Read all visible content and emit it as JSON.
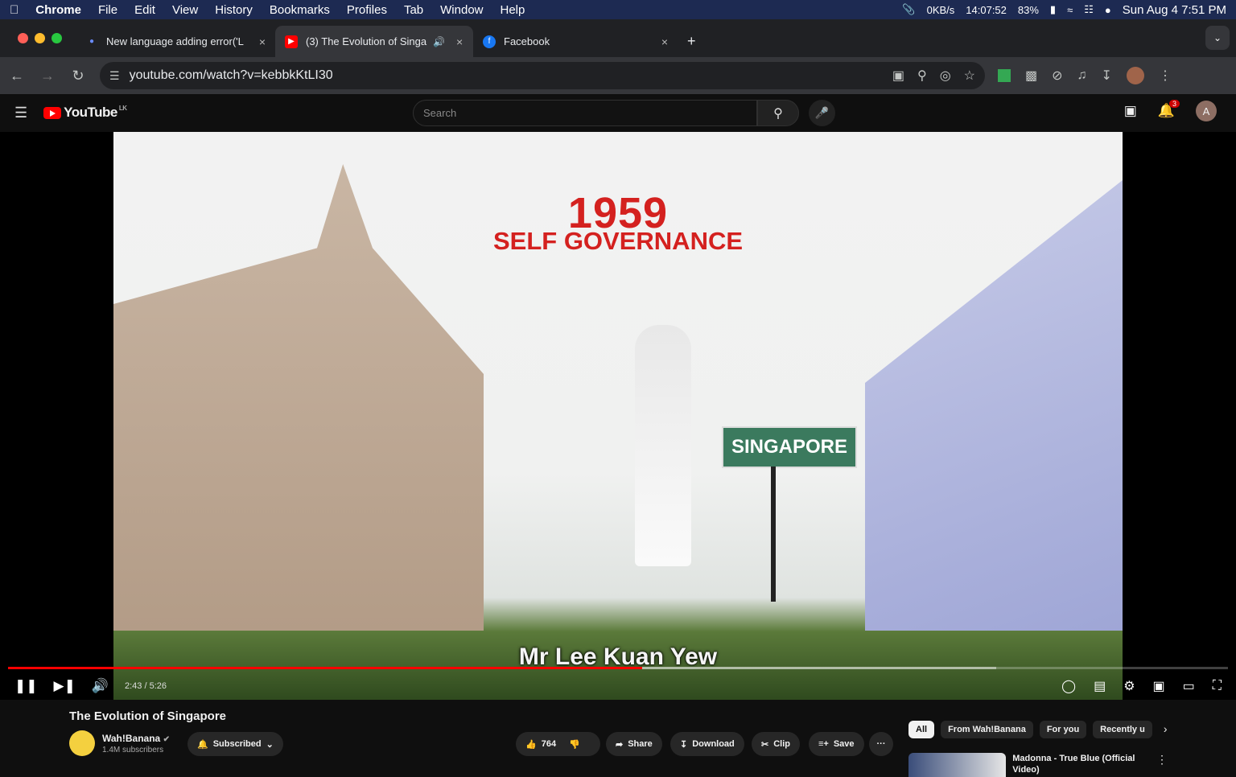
{
  "menubar": {
    "app": "Chrome",
    "items": [
      "File",
      "Edit",
      "View",
      "History",
      "Bookmarks",
      "Profiles",
      "Tab",
      "Window",
      "Help"
    ],
    "net": "0KB/s",
    "timer": "14:07:52",
    "battery": "83%",
    "clock": "Sun Aug 4  7:51 PM"
  },
  "tabs": [
    {
      "title": "New language adding error('L",
      "close": "×"
    },
    {
      "title": "(3) The Evolution of Singa",
      "close": "×"
    },
    {
      "title": "Facebook",
      "close": "×"
    }
  ],
  "address": {
    "url": "youtube.com/watch?v=kebbkKtLI30"
  },
  "youtube": {
    "logo": "YouTube",
    "region": "LK",
    "search_placeholder": "Search",
    "notif_count": "3",
    "avatar_letter": "A"
  },
  "video": {
    "year": "1959",
    "headline": "SELF GOVERNANCE",
    "sign": "SINGAPORE",
    "caption": "Mr Lee Kuan Yew",
    "time": "2:43 / 5:26",
    "progress": 0.52,
    "buffered": 0.81
  },
  "meta": {
    "title": "The Evolution of Singapore",
    "channel": "Wah!Banana",
    "subscribers": "1.4M subscribers",
    "subscribed": "Subscribed",
    "likes": "764",
    "share": "Share",
    "download": "Download",
    "clip": "Clip",
    "save": "Save",
    "more": "···"
  },
  "chips": [
    "All",
    "From Wah!Banana",
    "For you",
    "Recently u"
  ],
  "recommended": {
    "title": "Madonna - True Blue (Official Video)"
  }
}
